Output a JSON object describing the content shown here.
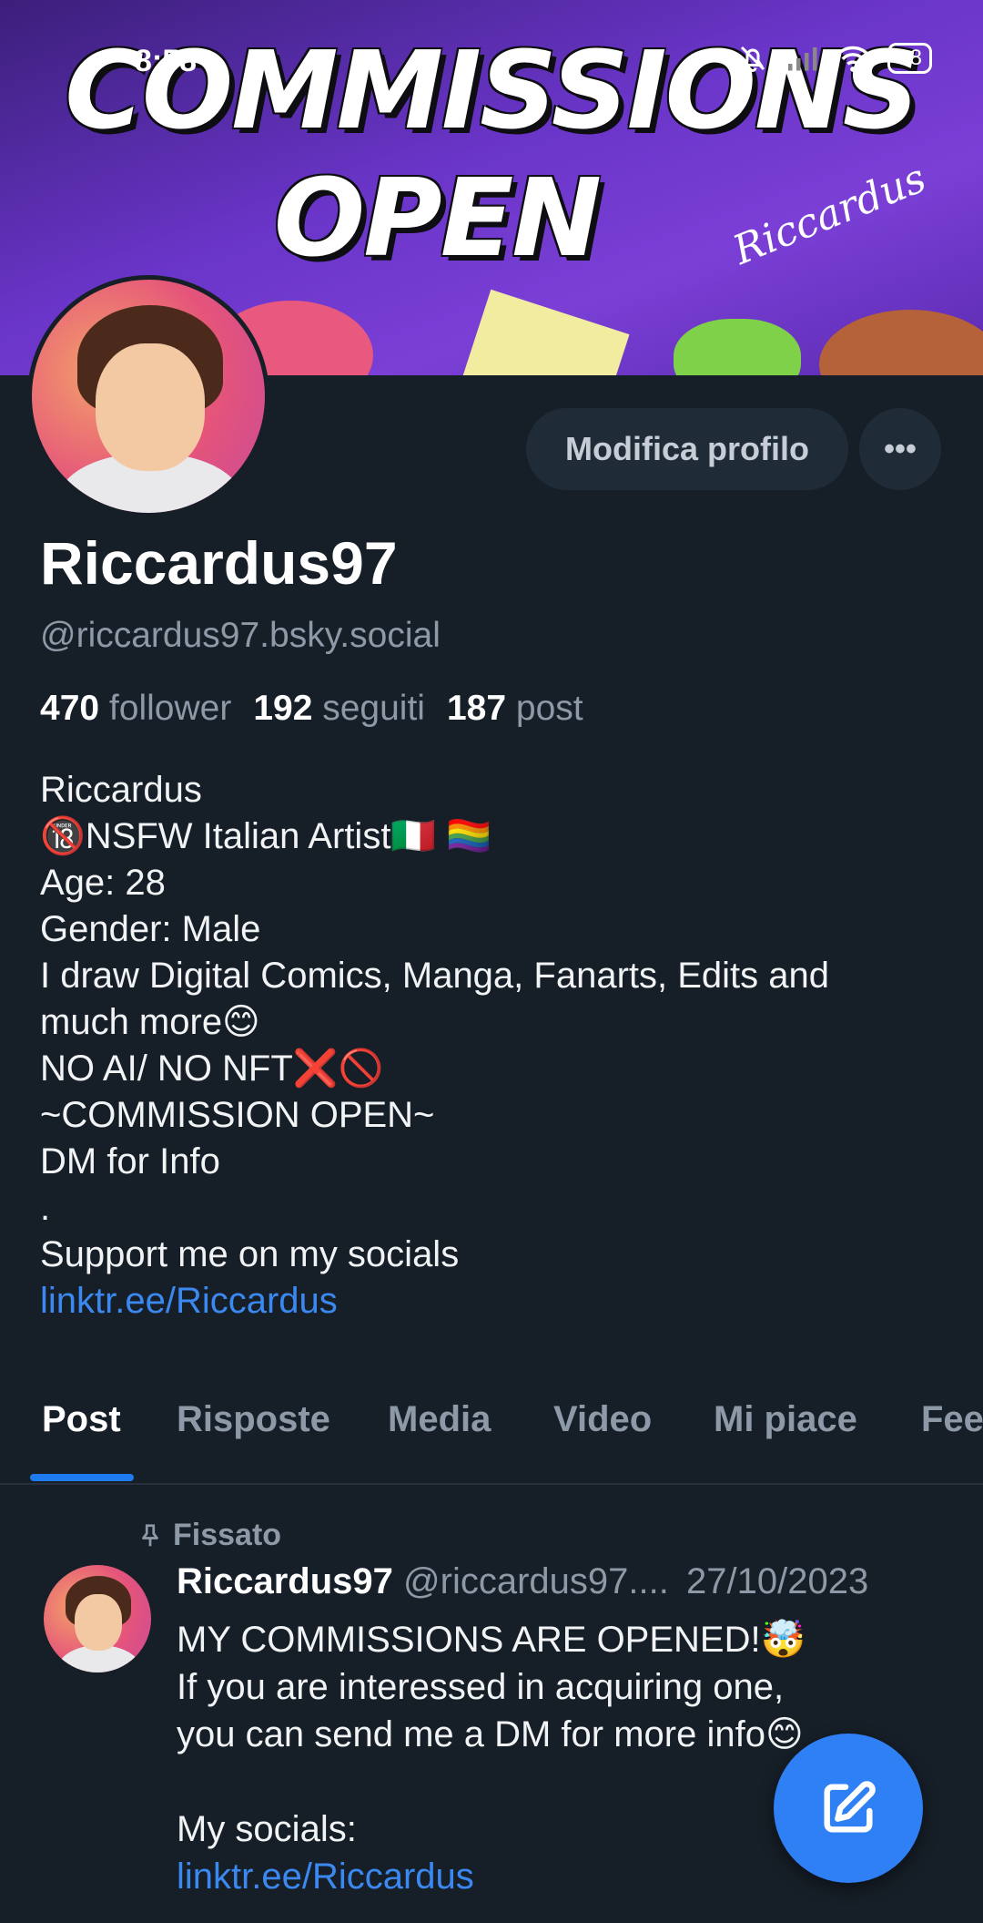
{
  "status_bar": {
    "time": "8:58",
    "battery": "38"
  },
  "banner": {
    "line1": "COMMISSIONS",
    "line2": "OPEN",
    "signature": "Riccardus"
  },
  "profile": {
    "display_name": "Riccardus97",
    "handle": "@riccardus97.bsky.social",
    "edit_label": "Modifica profilo",
    "more_label": "•••",
    "stats": {
      "followers_count": "470",
      "followers_label": "follower",
      "following_count": "192",
      "following_label": "seguiti",
      "posts_count": "187",
      "posts_label": "post"
    },
    "bio": [
      "Riccardus",
      "🔞NSFW Italian Artist🇮🇹 🏳️‍🌈",
      "Age: 28",
      "Gender: Male",
      "I draw Digital Comics, Manga, Fanarts, Edits and",
      "much more😊",
      "NO AI/ NO NFT❌🚫",
      "~COMMISSION OPEN~",
      "DM for Info",
      ".",
      "Support me on my socials"
    ],
    "bio_link": "linktr.ee/Riccardus"
  },
  "tabs": [
    {
      "label": "Post",
      "active": true
    },
    {
      "label": "Risposte"
    },
    {
      "label": "Media"
    },
    {
      "label": "Video"
    },
    {
      "label": "Mi piace"
    },
    {
      "label": "Fee"
    }
  ],
  "pinned_post": {
    "pinned_label": "Fissato",
    "author": "Riccardus97",
    "handle": "@riccardus97....",
    "date": "27/10/2023",
    "lines": [
      "MY COMMISSIONS ARE OPENED!🤯",
      "If you are interessed in acquiring one,",
      "you can send me a DM for more info😊",
      "",
      "My socials:"
    ],
    "link": "linktr.ee/Riccardus"
  },
  "colors": {
    "accent": "#1e7bf0",
    "link": "#3b88f0",
    "background": "#161e27",
    "muted": "#8d99a6"
  }
}
